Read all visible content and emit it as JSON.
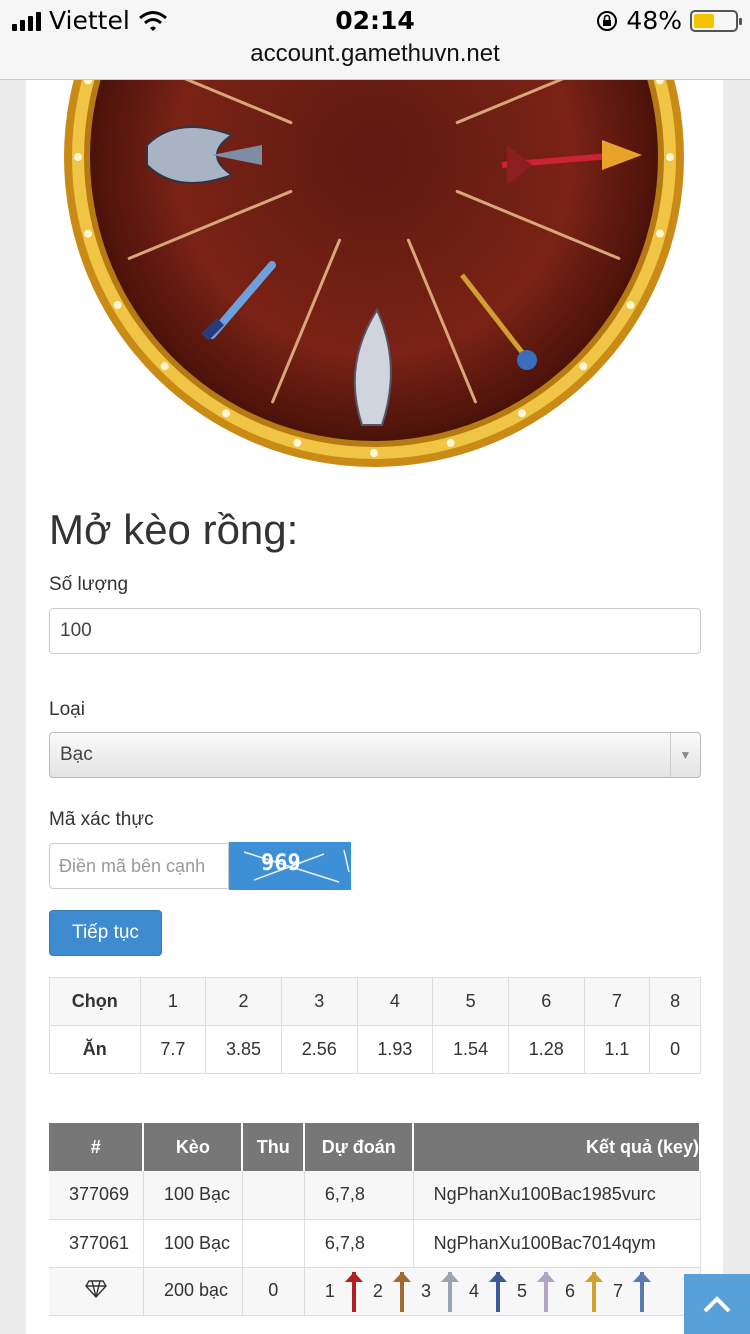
{
  "status_bar": {
    "carrier": "Viettel",
    "time": "02:14",
    "battery": "48%",
    "url": "account.gamethuvn.net"
  },
  "form": {
    "title": "Mở kèo rồng:",
    "quantity_label": "Số lượng",
    "quantity_value": "100",
    "type_label": "Loại",
    "type_value": "Bạc",
    "captcha_label": "Mã xác thực",
    "captcha_placeholder": "Điền mã bên cạnh",
    "captcha_text": "969",
    "submit_label": "Tiếp tục"
  },
  "odds_table": {
    "row1_header": "Chọn",
    "row2_header": "Ăn",
    "choices": [
      "1",
      "2",
      "3",
      "4",
      "5",
      "6",
      "7",
      "8"
    ],
    "payouts": [
      "7.7",
      "3.85",
      "2.56",
      "1.93",
      "1.54",
      "1.28",
      "1.1",
      "0"
    ]
  },
  "history_table": {
    "headers": [
      "#",
      "Kèo",
      "Thu",
      "Dự đoán",
      "Kết quả (key)"
    ],
    "rows": [
      {
        "id": "377069",
        "bet": "100 Bạc",
        "thu": "",
        "guess": "6,7,8",
        "result": "NgPhanXu100Bac1985vurc"
      },
      {
        "id": "377061",
        "bet": "100 Bạc",
        "thu": "",
        "guess": "6,7,8",
        "result": "NgPhanXu100Bac7014qym"
      }
    ],
    "summary_row": {
      "icon": "diamond-icon",
      "bet": "200 bạc",
      "thu": "0",
      "item_numbers": [
        "1",
        "2",
        "3",
        "4",
        "5",
        "6",
        "7"
      ]
    }
  },
  "colors": {
    "wheel_gold": "#d9a420",
    "wheel_red": "#7a1d12",
    "button_blue": "#3f8bd0",
    "header_gray": "#777777"
  }
}
